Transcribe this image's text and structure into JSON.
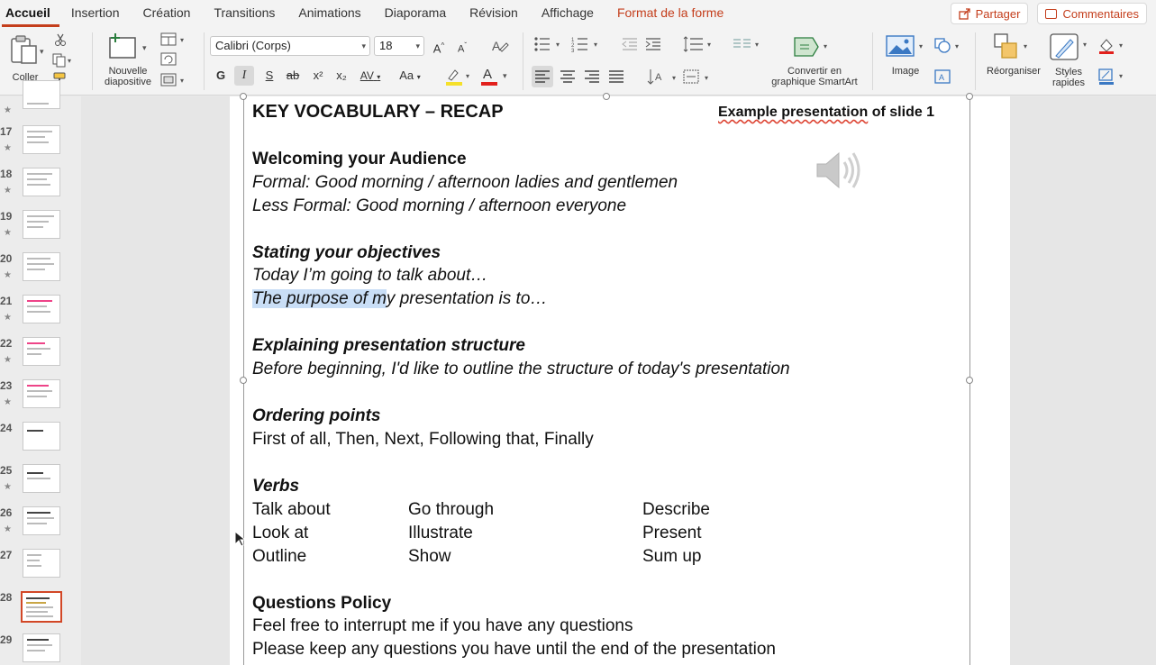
{
  "tabs": [
    "Accueil",
    "Insertion",
    "Création",
    "Transitions",
    "Animations",
    "Diaporama",
    "Révision",
    "Affichage",
    "Format de la forme"
  ],
  "share_label": "Partager",
  "comments_label": "Commentaires",
  "ribbon": {
    "paste_label": "Coller",
    "new_slide_label_1": "Nouvelle",
    "new_slide_label_2": "diapositive",
    "font_name": "Calibri (Corps)",
    "font_size": "18",
    "bold_glyph": "G",
    "italic_glyph": "I",
    "underline_glyph": "S",
    "strike_glyph": "ab",
    "superscript_glyph": "x²",
    "subscript_glyph": "x₂",
    "spacing_glyph": "AV",
    "case_glyph": "Aa",
    "color_glyph": "A",
    "grow_glyph": "A",
    "shrink_glyph": "A",
    "smartart_label_1": "Convertir en",
    "smartart_label_2": "graphique SmartArt",
    "image_label": "Image",
    "arrange_label": "Réorganiser",
    "styles_label_1": "Styles",
    "styles_label_2": "rapides"
  },
  "thumbnails": [
    {
      "num": "",
      "star": "★"
    },
    {
      "num": "17",
      "star": "★"
    },
    {
      "num": "18",
      "star": "★"
    },
    {
      "num": "19",
      "star": "★"
    },
    {
      "num": "20",
      "star": "★"
    },
    {
      "num": "21",
      "star": "★"
    },
    {
      "num": "22",
      "star": "★"
    },
    {
      "num": "23",
      "star": "★"
    },
    {
      "num": "24",
      "star": ""
    },
    {
      "num": "25",
      "star": "★"
    },
    {
      "num": "26",
      "star": "★"
    },
    {
      "num": "27",
      "star": ""
    },
    {
      "num": "28",
      "star": ""
    },
    {
      "num": "29",
      "star": ""
    }
  ],
  "selected_slide": "28",
  "slide": {
    "title": "KEY VOCABULARY – RECAP",
    "example_pre": "Example presentation",
    "example_post": " of slide 1",
    "welcome_heading": "Welcoming your Audience",
    "welcome_formal": "Formal: Good morning / afternoon ladies and gentlemen",
    "welcome_less": "Less Formal: Good morning / afternoon everyone",
    "objectives_heading": "Stating your objectives",
    "objectives_1": "Today I’m going to talk about…",
    "objectives_2_hl": "The purpose of m",
    "objectives_2_rest": "y presentation is to…",
    "structure_heading": "Explaining presentation structure",
    "structure_1": "Before beginning, I'd like to outline the structure of today's presentation",
    "ordering_heading": "Ordering points",
    "ordering_1": "First of all, Then, Next, Following that, Finally",
    "verbs_heading": "Verbs",
    "verbs": [
      [
        "Talk about",
        "Go through",
        "Describe"
      ],
      [
        "Look at",
        "Illustrate",
        "Present"
      ],
      [
        "Outline",
        "Show",
        "Sum up"
      ]
    ],
    "questions_heading": "Questions Policy",
    "questions_1": "Feel free to interrupt me if you have any questions",
    "questions_2": "Please keep any questions you have until the end of the presentation"
  }
}
